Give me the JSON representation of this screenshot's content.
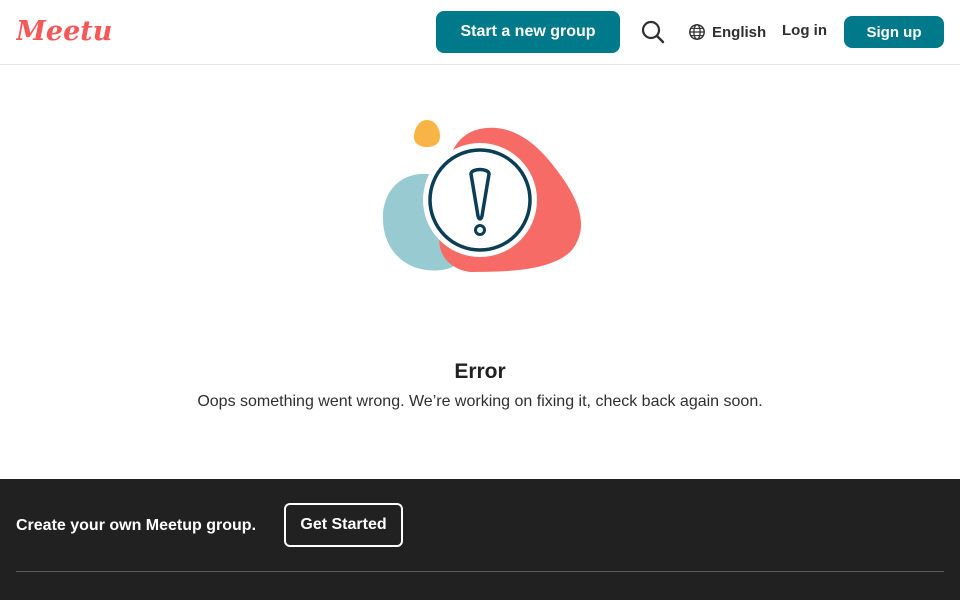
{
  "header": {
    "logo_text": "Meetup",
    "start_group_label": "Start a new group",
    "search_icon": "search-icon",
    "language_icon": "globe-icon",
    "language_label": "English",
    "login_label": "Log in",
    "signup_label": "Sign up"
  },
  "main": {
    "illustration_icon": "exclamation-icon",
    "error_title": "Error",
    "error_message": "Oops something went wrong. We’re working on fixing it, check back again soon."
  },
  "footer": {
    "cta_text": "Create your own Meetup group.",
    "get_started_label": "Get Started"
  },
  "colors": {
    "brand_red": "#f65858",
    "primary_teal": "#00798a",
    "footer_bg": "#212121",
    "blob_blue": "#97cad1",
    "blob_orange": "#f8b444",
    "icon_navy": "#0a3e56"
  }
}
